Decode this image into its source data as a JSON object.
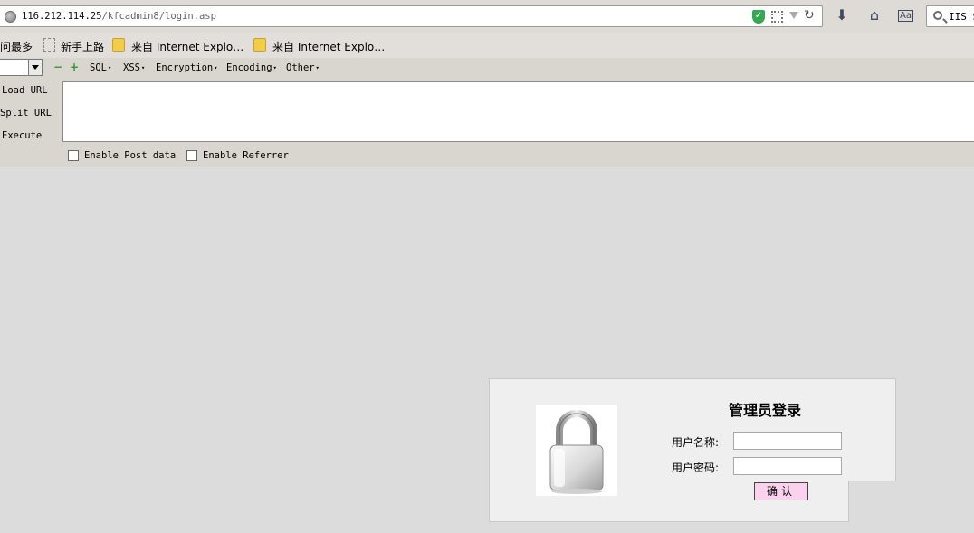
{
  "address_bar": {
    "url_host": "116.212.114.25",
    "url_path": "/kfcadmin8/login.asp"
  },
  "toolbar": {
    "icons": [
      "download-icon",
      "home-icon",
      "reader-view-icon"
    ]
  },
  "search_box": {
    "text": "IIS S"
  },
  "bookmarks": {
    "items": [
      {
        "label": "访问最多"
      },
      {
        "label": "新手上路"
      },
      {
        "label": "来自 Internet Explo…"
      },
      {
        "label": "来自 Internet Explo…"
      }
    ]
  },
  "hackbar": {
    "menus": [
      {
        "label": "SQL"
      },
      {
        "label": "XSS"
      },
      {
        "label": "Encryption"
      },
      {
        "label": "Encoding"
      },
      {
        "label": "Other"
      }
    ],
    "buttons": {
      "load": "Load URL",
      "split": "Split URL",
      "execute": "Execute"
    },
    "checkboxes": {
      "post": "Enable Post data",
      "referrer": "Enable Referrer"
    }
  },
  "login": {
    "title": "管理员登录",
    "username_label": "用户名称:",
    "password_label": "用户密码:",
    "submit_label": "确认"
  },
  "colors": {
    "page_bg": "#dcdcdc",
    "panel_bg": "#efefef",
    "submit_bg": "#fbd2ee",
    "shield_green": "#34a853"
  }
}
